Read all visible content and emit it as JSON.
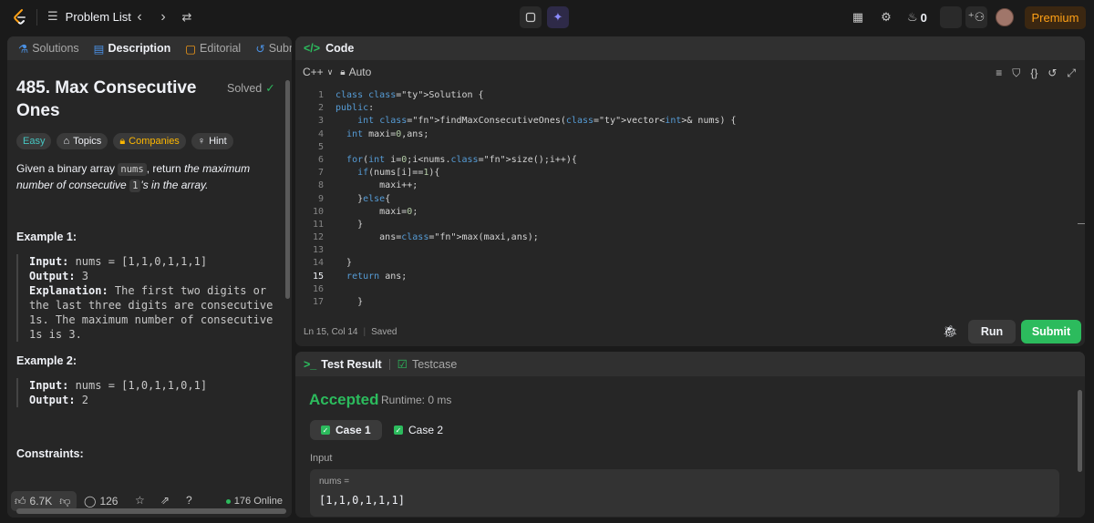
{
  "topbar": {
    "problem_list": "Problem List",
    "streak_count": "0",
    "premium": "Premium"
  },
  "left_tabs": [
    "Solutions",
    "Description",
    "Editorial",
    "Submissio"
  ],
  "problem": {
    "title": "485. Max Consecutive Ones",
    "solved": "Solved",
    "chips": [
      "Easy",
      "Topics",
      "Companies",
      "Hint"
    ],
    "desc_part1": "Given a binary array ",
    "desc_code1": "nums",
    "desc_part2": ", return ",
    "desc_italic1": "the maximum number of consecutive ",
    "desc_code2": "1",
    "desc_italic2": "'s in the array."
  },
  "examples": [
    {
      "heading": "Example 1:",
      "input_label": "Input:",
      "input": " nums = [1,1,0,1,1,1]",
      "output_label": "Output:",
      "output": " 3",
      "explanation_label": "Explanation:",
      "explanation": " The first two digits or the last three digits are consecutive 1s. The maximum number of consecutive 1s is 3."
    },
    {
      "heading": "Example 2:",
      "input_label": "Input:",
      "input": " nums = [1,0,1,1,0,1]",
      "output_label": "Output:",
      "output": " 2"
    }
  ],
  "constraints_heading": "Constraints:",
  "left_footer": {
    "likes": "6.7K",
    "comments": "126",
    "online": "176 Online"
  },
  "code_panel": {
    "title": "Code",
    "language": "C++",
    "mode": "Auto",
    "status_position": "Ln 15, Col 14",
    "status_saved": "Saved",
    "run": "Run",
    "submit": "Submit"
  },
  "code_lines": [
    "class Solution {",
    "public:",
    "    int findMaxConsecutiveOnes(vector<int>& nums) {",
    "  int maxi=0,ans;",
    "",
    "  for(int i=0;i<nums.size();i++){",
    "    if(nums[i]==1){",
    "        maxi++;",
    "    }else{",
    "        maxi=0;",
    "    }",
    "        ans=max(maxi,ans);",
    "",
    "  }",
    "  return ans;",
    "",
    "    }"
  ],
  "test_panel": {
    "tab_result": "Test Result",
    "tab_testcase": "Testcase",
    "verdict": "Accepted",
    "runtime": "Runtime: 0 ms",
    "case1": "Case 1",
    "case2": "Case 2",
    "input_label": "Input",
    "var_name": "nums =",
    "var_value": "[1,1,0,1,1,1]"
  },
  "colors": {
    "accent_green": "#2cbb5d",
    "premium_orange": "#ffa116",
    "easy_teal": "#46c6c2"
  }
}
